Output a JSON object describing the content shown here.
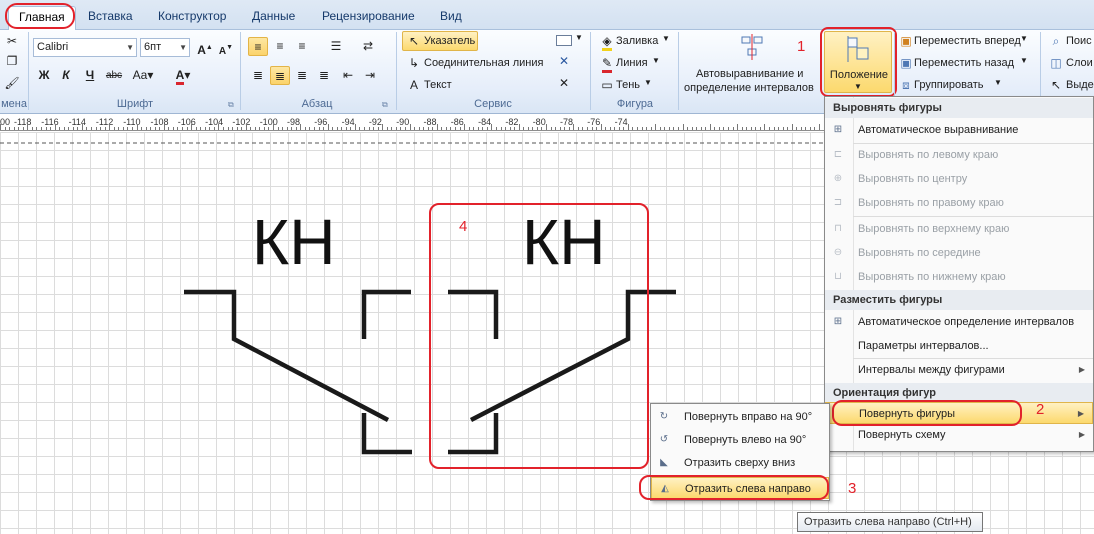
{
  "tabs": [
    {
      "label": "Главная",
      "active": true
    },
    {
      "label": "Вставка"
    },
    {
      "label": "Конструктор"
    },
    {
      "label": "Данные"
    },
    {
      "label": "Рецензирование"
    },
    {
      "label": "Вид"
    }
  ],
  "ribbon": {
    "font": {
      "name": "Calibri",
      "size": "6пт",
      "label": "Шрифт"
    },
    "paragraph": {
      "label": "Абзац"
    },
    "clipboard": {
      "label": "мена"
    },
    "tools": {
      "pointer": "Указатель",
      "connector": "Соединительная линия",
      "text": "Текст",
      "label": "Сервис"
    },
    "shape": {
      "fill": "Заливка",
      "line": "Линия",
      "shadow": "Тень",
      "label": "Фигура"
    },
    "arrange": {
      "autoalign_line1": "Автовыравнивание и",
      "autoalign_line2": "определение интервалов",
      "position": "Положение"
    },
    "order": {
      "bring_forward": "Переместить вперед",
      "send_backward": "Переместить назад",
      "group": "Группировать"
    },
    "edit": {
      "find": "Поис",
      "layers": "Слои",
      "select": "Выде"
    }
  },
  "ruler": {
    "labels": [
      "00",
      "-118",
      "-116",
      "-114",
      "-112",
      "-110",
      "-108",
      "-106",
      "-104",
      "-102",
      "-100",
      "-98",
      "-96",
      "-94",
      "-92",
      "-90",
      "-88",
      "-86",
      "-84",
      "-82",
      "-80",
      "-78",
      "-76",
      "-74"
    ]
  },
  "canvas": {
    "left_label": "КН",
    "right_label": "КН"
  },
  "position_menu": {
    "align_header": "Выровнять фигуры",
    "auto_align": "Автоматическое выравнивание",
    "align_left": "Выровнять по левому краю",
    "align_center": "Выровнять по центру",
    "align_right": "Выровнять по правому краю",
    "align_top": "Выровнять по верхнему краю",
    "align_middle": "Выровнять по середине",
    "align_bottom": "Выровнять по нижнему краю",
    "space_header": "Разместить фигуры",
    "auto_space": "Автоматическое определение интервалов",
    "space_options": "Параметры интервалов...",
    "spacing_between": "Интервалы между фигурами",
    "orient_header": "Ориентация фигур",
    "rotate_shapes": "Повернуть фигуры",
    "rotate_diagram": "Повернуть схему"
  },
  "rotate_submenu": {
    "rotate_right": "Повернуть вправо на 90°",
    "rotate_left": "Повернуть влево на 90°",
    "flip_vertical": "Отразить сверху вниз",
    "flip_horizontal": "Отразить слева направо"
  },
  "tooltip": "Отразить слева направо (Ctrl+H)",
  "annotations": {
    "n1": "1",
    "n2": "2",
    "n3": "3",
    "n4": "4"
  },
  "colors": {
    "annotation_red": "#e2222b",
    "highlight": "#fcd96e",
    "shape_stroke": "#1a1a1a"
  }
}
